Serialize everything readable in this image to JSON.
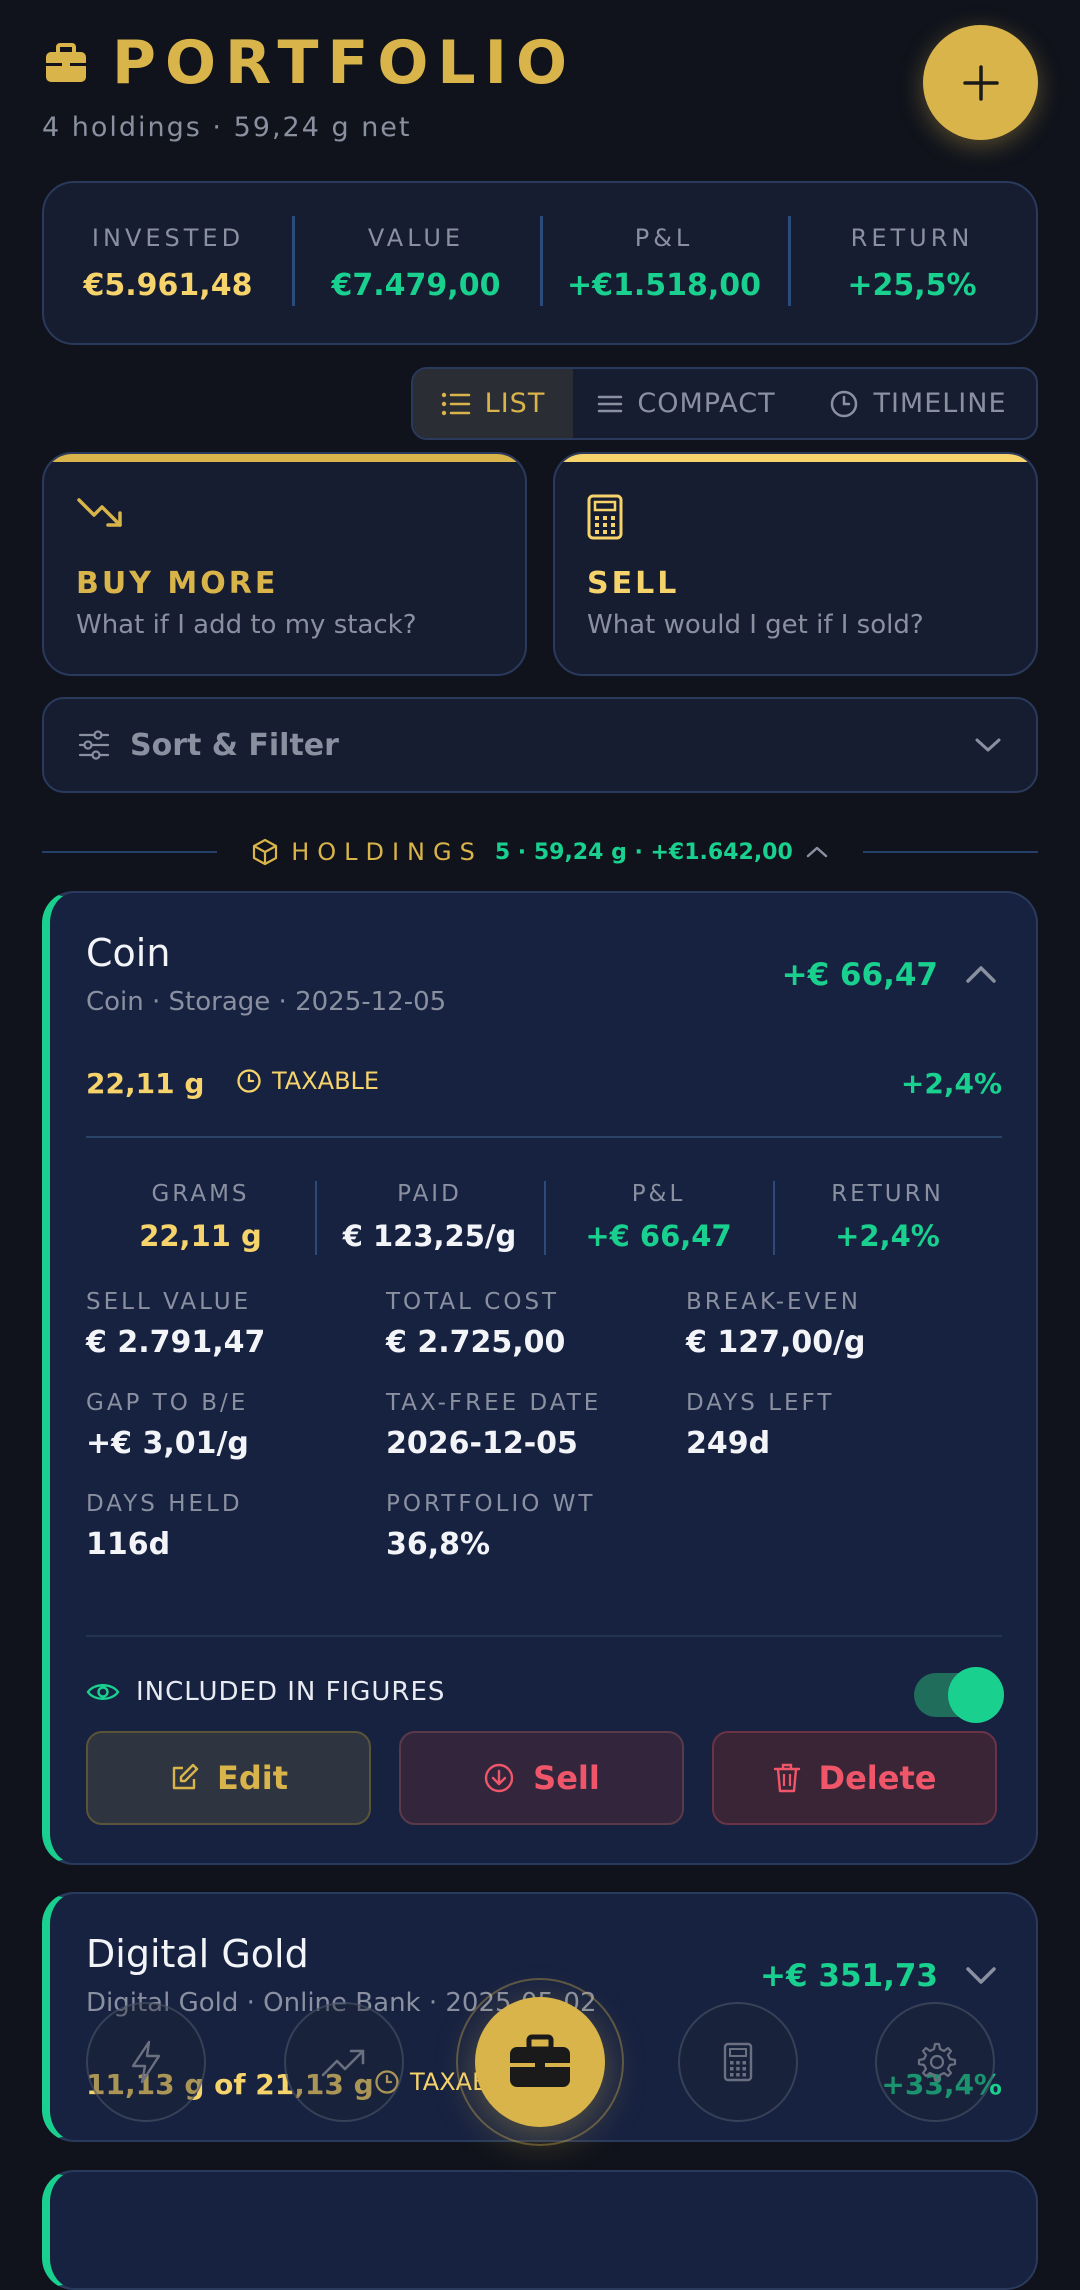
{
  "header": {
    "title": "PORTFOLIO",
    "subtitle": "4 holdings  ·  59,24 g net",
    "add_label": "+"
  },
  "summary": [
    {
      "label": "INVESTED",
      "value": "€5.961,48",
      "color": "#f6d36b"
    },
    {
      "label": "VALUE",
      "value": "€7.479,00",
      "color": "#19d08f"
    },
    {
      "label": "P&L",
      "value": "+€1.518,00",
      "color": "#19d08f"
    },
    {
      "label": "RETURN",
      "value": "+25,5%",
      "color": "#19d08f"
    }
  ],
  "view_tabs": [
    {
      "label": "LIST",
      "icon": "list-icon",
      "active": true
    },
    {
      "label": "COMPACT",
      "icon": "compact-lines-icon",
      "active": false
    },
    {
      "label": "TIMELINE",
      "icon": "clock-icon",
      "active": false
    }
  ],
  "actions": {
    "buy": {
      "title": "BUY MORE",
      "subtitle": "What if I add to my stack?",
      "icon": "trend-down-icon"
    },
    "sell": {
      "title": "SELL",
      "subtitle": "What would I get if I sold?",
      "icon": "calculator-icon"
    }
  },
  "sort_filter": {
    "label": "Sort & Filter"
  },
  "holdings_header": {
    "label": "HOLDINGS",
    "stats": "5 · 59,24 g · +€1.642,00"
  },
  "holding1": {
    "name": "Coin",
    "meta": "Coin  ·  Storage  ·  2025-12-05",
    "pnl": "+€ 66,47",
    "grams": "22,11 g",
    "tax": "TAXABLE",
    "return": "+2,4%",
    "stats": [
      {
        "label": "GRAMS",
        "value": "22,11 g",
        "color": "#f6d36b"
      },
      {
        "label": "PAID",
        "value": "€ 123,25/g",
        "color": "#f2f4f8"
      },
      {
        "label": "P&L",
        "value": "+€ 66,47",
        "color": "#19d08f"
      },
      {
        "label": "RETURN",
        "value": "+2,4%",
        "color": "#19d08f"
      }
    ],
    "details": [
      {
        "label": "SELL VALUE",
        "value": "€ 2.791,47",
        "color": "#f2f4f8"
      },
      {
        "label": "TOTAL COST",
        "value": "€ 2.725,00",
        "color": "#f2f4f8"
      },
      {
        "label": "BREAK-EVEN",
        "value": "€ 127,00/g",
        "color": "#f2f4f8"
      },
      {
        "label": "GAP TO B/E",
        "value": "+€ 3,01/g",
        "color": "#19d08f"
      },
      {
        "label": "TAX-FREE DATE",
        "value": "2026-12-05",
        "color": "#f2f4f8"
      },
      {
        "label": "DAYS LEFT",
        "value": "249d",
        "color": "#f6d36b"
      },
      {
        "label": "DAYS HELD",
        "value": "116d",
        "color": "#f2f4f8"
      },
      {
        "label": "PORTFOLIO WT",
        "value": "36,8%",
        "color": "#f2f4f8"
      }
    ],
    "included_label": "INCLUDED IN FIGURES",
    "included": true,
    "buttons": {
      "edit": "Edit",
      "sell": "Sell",
      "delete": "Delete"
    }
  },
  "holding2": {
    "name": "Digital Gold",
    "meta": "Digital Gold  ·  Online Bank  ·  2025-05-02",
    "pnl": "+€ 351,73",
    "grams": "11,13 g of 21,13 g",
    "tax": "TAXABLE",
    "return": "+33,4%"
  },
  "bottom_nav": [
    {
      "name": "nav-quick",
      "icon": "lightning-icon"
    },
    {
      "name": "nav-chart",
      "icon": "trend-up-icon"
    },
    {
      "name": "nav-portfolio",
      "icon": "briefcase-icon",
      "active": true
    },
    {
      "name": "nav-calculator",
      "icon": "calculator-icon"
    },
    {
      "name": "nav-settings",
      "icon": "gear-icon"
    }
  ]
}
